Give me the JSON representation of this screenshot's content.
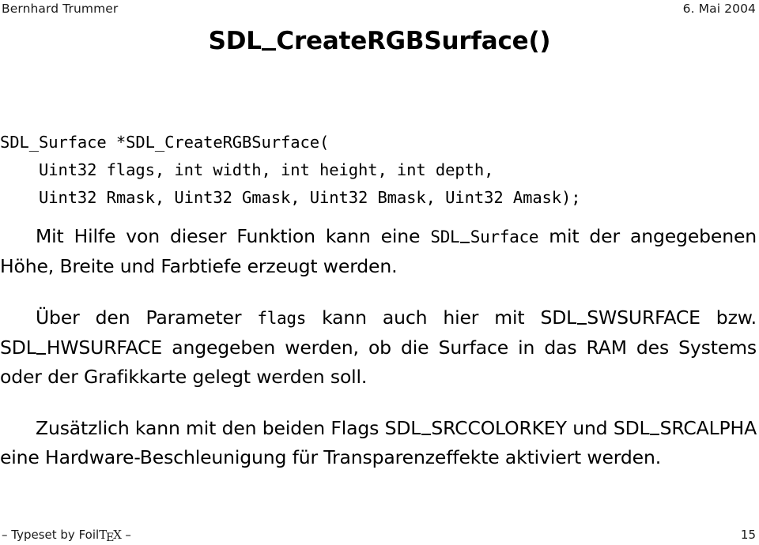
{
  "header": {
    "author": "Bernhard Trummer",
    "date": "6. Mai 2004"
  },
  "title": {
    "prefix": "SDL",
    "suffix": "CreateRGBSurface()"
  },
  "code": {
    "line1": "SDL_Surface *SDL_CreateRGBSurface(",
    "line2": "    Uint32 flags, int width, int height, int depth,",
    "line3": "    Uint32 Rmask, Uint32 Gmask, Uint32 Bmask, Uint32 Amask);"
  },
  "body": {
    "paragraph1": {
      "part1": "Mit Hilfe von dieser Funktion kann eine ",
      "mono1_prefix": "SDL",
      "mono1_suffix": "Surface",
      "part2": " mit der angegebenen Höhe, Breite und Farbtiefe erzeugt werden."
    },
    "paragraph2": {
      "part1": "Über den Parameter ",
      "mono1": "flags",
      "part2": " kann auch hier mit ",
      "const1_prefix": "SDL",
      "const1_suffix": "SWSURFACE",
      "part3": " bzw. ",
      "const2_prefix": "SDL",
      "const2_suffix": "HWSURFACE",
      "part4": " angegeben werden, ob die Surface in das RAM des Systems oder der Grafikkarte gelegt werden soll."
    },
    "paragraph3": {
      "part1": "Zusätzlich kann mit den beiden Flags ",
      "const1_prefix": "SDL",
      "const1_suffix": "SRCCOLORKEY",
      "part2": " und ",
      "const2_prefix": "SDL",
      "const2_suffix": "SRCALPHA",
      "part3": " eine Hardware-Beschleunigung für Transparenzeffekte aktiviert werden."
    }
  },
  "footer": {
    "dash_left": "– Typeset by Foil",
    "tex_t": "T",
    "tex_e": "E",
    "tex_x": "X",
    "dash_right": " –",
    "page_number": "15"
  }
}
